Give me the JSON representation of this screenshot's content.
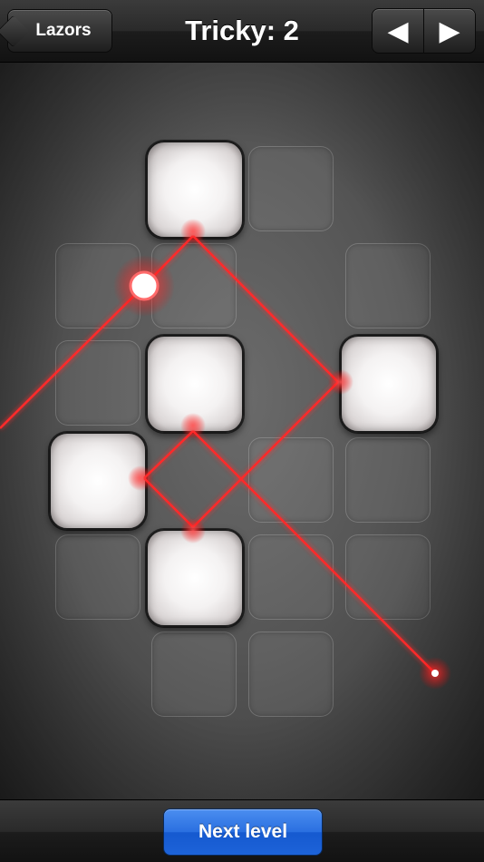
{
  "header": {
    "back_label": "Lazors",
    "title": "Tricky: 2",
    "prev_glyph": "◀",
    "next_glyph": "▶"
  },
  "footer": {
    "next_level_label": "Next level"
  },
  "colors": {
    "laser": "#ff2a2a",
    "accent_button": "#2a6fe0"
  },
  "board": {
    "grid_columns": 4,
    "grid_rows": 6,
    "empty_slots": [
      [
        1,
        0
      ],
      [
        0,
        1
      ],
      [
        1,
        1
      ],
      [
        3,
        1
      ],
      [
        0,
        2
      ],
      [
        2,
        3
      ],
      [
        3,
        3
      ],
      [
        0,
        4
      ],
      [
        2,
        4
      ],
      [
        3,
        4
      ],
      [
        1,
        5
      ],
      [
        2,
        5
      ]
    ],
    "reflect_blocks": [
      [
        1,
        0
      ],
      [
        1,
        2
      ],
      [
        3,
        2
      ],
      [
        0,
        3
      ],
      [
        1,
        4
      ]
    ],
    "laser_source_icon": "laser-source-icon",
    "target_icon": "target-point-icon"
  }
}
